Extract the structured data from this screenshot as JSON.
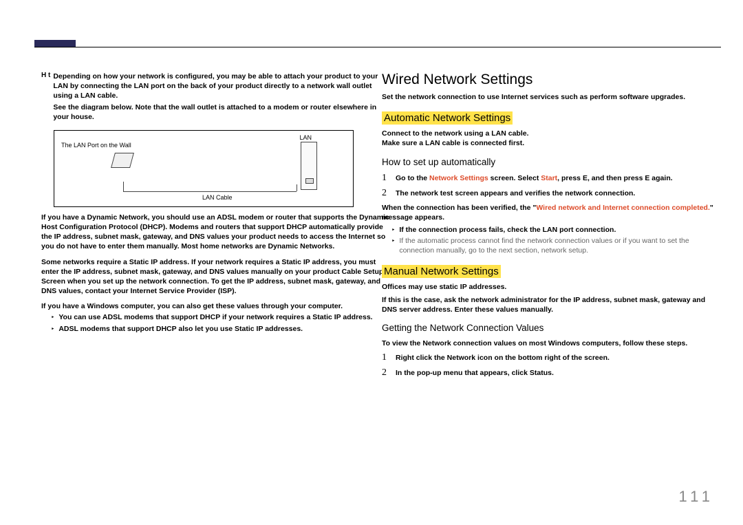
{
  "page_number": "111",
  "left": {
    "note_mark": "H t",
    "note_p1": "Depending on how your network is configured, you may be able to attach your product to your LAN by connecting the LAN port on the back of your product directly to a network wall outlet using a LAN cable.",
    "note_p2": "See the diagram below. Note that the wall outlet is attached to a modem or router elsewhere in your house.",
    "diagram": {
      "lan": "LAN",
      "wall": "The LAN Port on the Wall",
      "cable": "LAN Cable"
    },
    "p3": "If you have a Dynamic Network, you should use an ADSL modem or router that supports the Dynamic Host Configuration Protocol (DHCP). Modems and routers that support DHCP automatically provide the IP address, subnet mask, gateway, and DNS values your product needs to access the Internet so you do not have to enter them manually. Most home networks are Dynamic Networks.",
    "p4": "Some networks require a Static IP address. If your network requires a Static IP address, you must enter the IP address, subnet mask, gateway, and DNS values manually on your product Cable Setup Screen when you set up the network connection. To get the IP address, subnet mask, gateway, and DNS values, contact your Internet Service Provider (ISP).",
    "p5": "If you have a Windows computer, you can also get these values through your computer.",
    "b1": "You can use ADSL modems that support DHCP if your network requires a Static IP address.",
    "b2": "ADSL modems that support DHCP also let you use Static IP addresses."
  },
  "right": {
    "h1": "Wired Network Settings",
    "p1": "Set the network connection to use Internet services such as perform software upgrades.",
    "h2a": "Automatic Network Settings",
    "p2": "Connect to the network using a LAN cable.",
    "p3": "Make sure a LAN cable is connected first.",
    "h3a": "How to set up automatically",
    "step1_num": "1",
    "step1_pre": "Go to the ",
    "step1_red": "Network Settings",
    "step1_mid": " screen. Select ",
    "step1_red2": "Start",
    "step1_post": ", press E, and then press E again.",
    "step2_num": "2",
    "step2": "The network test screen appears and verifies the network connection.",
    "verify_pre": "When the connection has been verified, the \"",
    "verify_red": "Wired network and Internet connection completed.",
    "verify_post": "\" message appears.",
    "sub1": "If the connection process fails, check the LAN port connection.",
    "sub2": "If the automatic process cannot find the network connection values or if you want to set the connection manually, go to the next section, network setup.",
    "h2b": "Manual Network Settings",
    "p4": "Offices may use static IP addresses.",
    "p5": "If this is the case, ask the network administrator for the IP address, subnet mask, gateway and DNS server address. Enter these values manually.",
    "h3b": "Getting the Network Connection Values",
    "p6": "To view the Network connection values on most Windows computers, follow these steps.",
    "stepg1_num": "1",
    "stepg1": "Right click the Network icon on the bottom right of the screen.",
    "stepg2_num": "2",
    "stepg2": "In the pop-up menu that appears, click Status."
  }
}
